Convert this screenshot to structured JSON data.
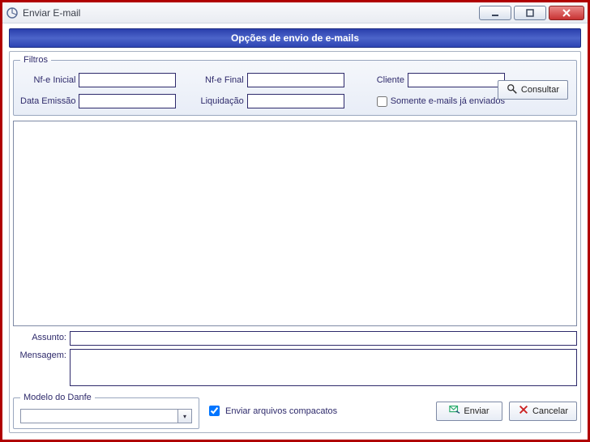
{
  "window": {
    "title": "Enviar E-mail"
  },
  "banner": {
    "title": "Opções de envio de e-mails"
  },
  "filters": {
    "legend": "Filtros",
    "nfe_inicial_label": "Nf-e Inicial",
    "nfe_inicial_value": "",
    "nfe_final_label": "Nf-e Final",
    "nfe_final_value": "",
    "cliente_label": "Cliente",
    "cliente_value": "",
    "data_emissao_label": "Data Emissão",
    "data_emissao_value": "",
    "liquidacao_label": "Liquidação",
    "liquidacao_value": "",
    "somente_enviados_label": "Somente e-mails já enviados",
    "consultar_label": "Consultar"
  },
  "assunto": {
    "label": "Assunto:",
    "value": ""
  },
  "mensagem": {
    "label": "Mensagem:",
    "value": ""
  },
  "modelo": {
    "legend": "Modelo do Danfe",
    "value": ""
  },
  "compact": {
    "label": "Enviar arquivos compacatos"
  },
  "buttons": {
    "enviar": "Enviar",
    "cancelar": "Cancelar"
  }
}
